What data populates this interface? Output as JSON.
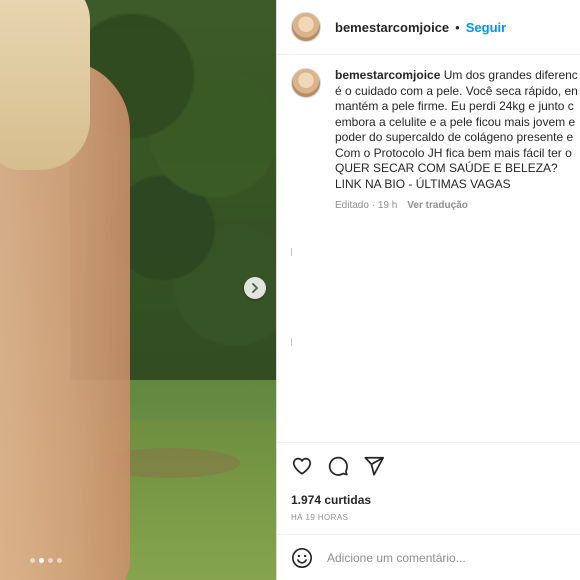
{
  "post": {
    "username": "bemestarcomjoice",
    "separator": "•",
    "follow_label": "Seguir"
  },
  "caption": {
    "username": "bemestarcomjoice",
    "lines": [
      "Um dos grandes diferenc",
      "é o cuidado com a pele. Você seca rápido, en",
      "mantém a pele firme. Eu perdi 24kg e junto c",
      "embora a celulite e a pele ficou mais jovem e",
      "poder do supercaldo de colágeno presente e",
      "Com o Protocolo JH fica bem mais fácil ter o",
      "QUER SECAR COM SAÚDE E BELEZA?",
      "LINK NA BIO - ÚLTIMAS VAGAS"
    ],
    "edited": "Editado",
    "time": "19 h",
    "meta_sep": "·",
    "translate_label": "Ver tradução"
  },
  "actions": {
    "likes": "1.974 curtidas",
    "time_ago": "HÁ 19 HORAS"
  },
  "comment": {
    "placeholder": "Adicione um comentário..."
  },
  "media": {
    "carousel_count": 4,
    "carousel_active": 2,
    "next_icon": "chevron-right-icon"
  },
  "colors": {
    "accent": "#0095f6",
    "text": "#262626",
    "muted": "#8e8e8e"
  }
}
